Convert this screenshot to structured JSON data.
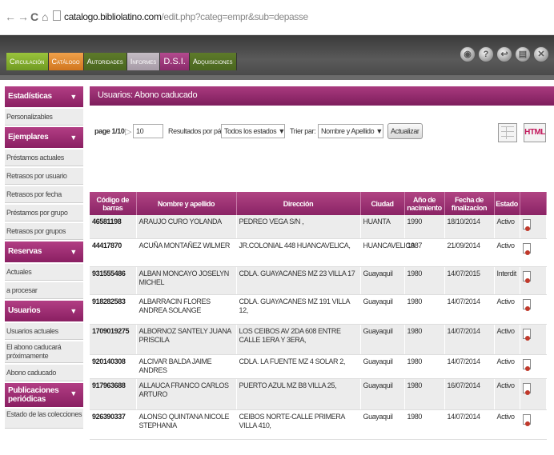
{
  "browser": {
    "back": "←",
    "forward": "→",
    "reload": "C",
    "home": "⌂",
    "url_host": "catalogo.bibliolatino.com",
    "url_path": "/edit.php?categ=empr&sub=depasse"
  },
  "main_tabs": [
    {
      "label": "Circulación",
      "style": "green"
    },
    {
      "label": "Catálogo",
      "style": "orange"
    },
    {
      "label": "Autoridades",
      "style": "dark"
    },
    {
      "label": "Informes",
      "style": "active"
    },
    {
      "label": "D.S.I.",
      "style": "purple"
    },
    {
      "label": "Adquisiciones",
      "style": "dark"
    }
  ],
  "top_icons": [
    "lock-icon",
    "help-icon",
    "exit-icon",
    "print-icon",
    "close-icon"
  ],
  "sidebar": {
    "sections": [
      {
        "title": "Estadísticas",
        "items": [
          "Personalizables"
        ]
      },
      {
        "title": "Ejemplares",
        "items": [
          "Préstamos actuales",
          "Retrasos por usuario",
          "Retrasos por fecha",
          "Préstamos por grupo",
          "Retrasos por grupos"
        ]
      },
      {
        "title": "Reservas",
        "items": [
          "Actuales",
          "a procesar"
        ]
      },
      {
        "title": "Usuarios",
        "items": [
          "Usuarios actuales",
          "El abono caducará próximamente",
          "Abono caducado"
        ]
      },
      {
        "title": "Publicaciones periódicas",
        "items": [
          "Estado de las colecciones"
        ]
      }
    ]
  },
  "content": {
    "title": "Usuarios: Abono caducado",
    "page_label": "page 1/10",
    "page_next": "▷",
    "per_page_value": "10",
    "per_page_label": "Resultados por página",
    "state_select": "Todos los estados",
    "sort_label": "Trier par:",
    "sort_select": "Nombre y Apellido",
    "update_button": "Actualizar",
    "html_icon_label": "HTML"
  },
  "table": {
    "headers": [
      "Código de barras",
      "Nombre y apellido",
      "Dirección",
      "Ciudad",
      "Año de nacimiento",
      "Fecha de finalizacion",
      "Estado",
      ""
    ],
    "rows": [
      [
        "46581198",
        "ARAUJO CURO YOLANDA",
        "PEDREO VEGA S/N ,",
        "HUANTA",
        "1990",
        "18/10/2014",
        "Activo"
      ],
      [
        "44417870",
        "ACUÑA MONTAÑEZ WILMER",
        "JR.COLONIAL 448 HUANCAVELICA,",
        "HUANCAVELICA",
        "1987",
        "21/09/2014",
        "Activo"
      ],
      [
        "931555486",
        "ALBAN MONCAYO JOSELYN MICHEL",
        "CDLA. GUAYACANES MZ 23 VILLA 17",
        "Guayaquil",
        "1980",
        "14/07/2015",
        "Interdit"
      ],
      [
        "918282583",
        "ALBARRACIN FLORES ANDREA SOLANGE",
        "CDLA. GUAYACANES MZ 191 VILLA 12,",
        "Guayaquil",
        "1980",
        "14/07/2014",
        "Activo"
      ],
      [
        "1709019275",
        "ALBORNOZ SANTELY JUANA PRISCILA",
        "LOS CEIBOS AV 2DA 608 ENTRE CALLE 1ERA Y 3ERA,",
        "Guayaquil",
        "1980",
        "14/07/2014",
        "Activo"
      ],
      [
        "920140308",
        "ALCIVAR BALDA JAIME ANDRES",
        "CDLA. LA FUENTE MZ 4 SOLAR 2,",
        "Guayaquil",
        "1980",
        "14/07/2014",
        "Activo"
      ],
      [
        "917963688",
        "ALLAUCA FRANCO CARLOS ARTURO",
        "PUERTO AZUL MZ B8 VILLA 25,",
        "Guayaquil",
        "1980",
        "16/07/2014",
        "Activo"
      ],
      [
        "926390337",
        "ALONSO QUINTANA NICOLE STEPHANIA",
        "CEIBOS NORTE-CALLE PRIMERA VILLA 410,",
        "Guayaquil",
        "1980",
        "14/07/2014",
        "Activo"
      ]
    ]
  }
}
